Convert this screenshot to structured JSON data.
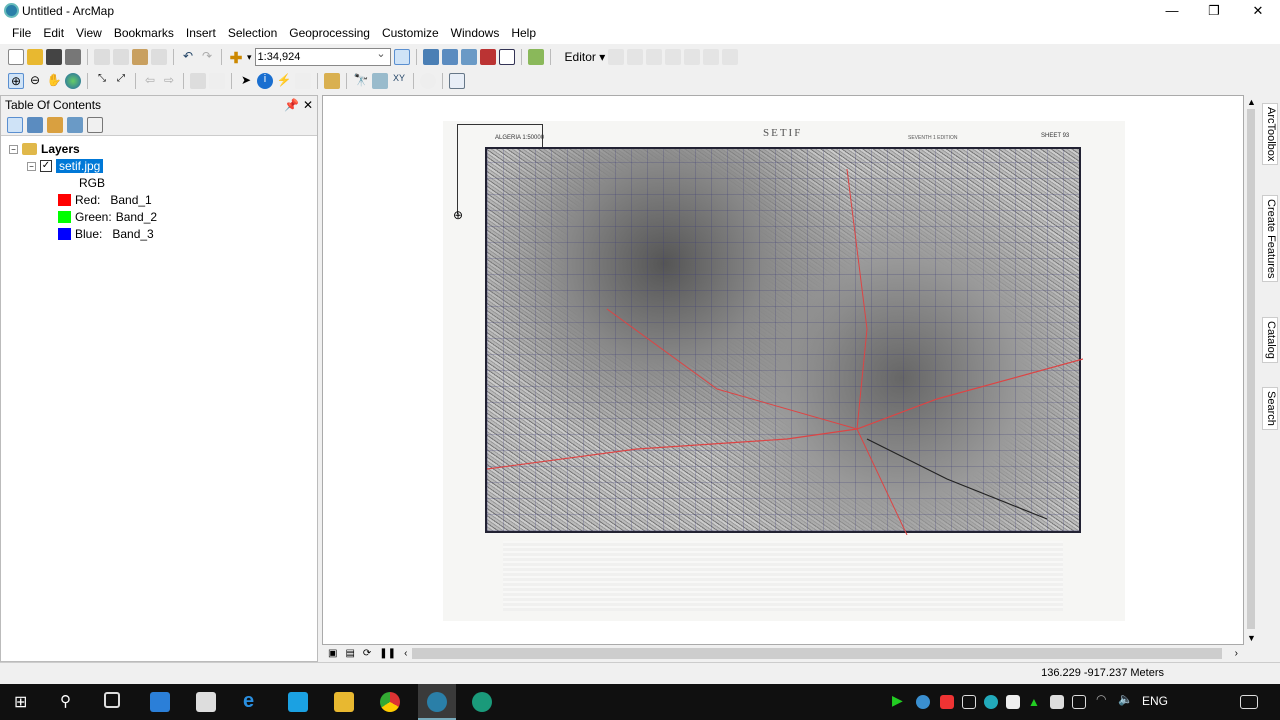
{
  "window": {
    "title": "Untitled - ArcMap",
    "minimize": "—",
    "restore": "❐",
    "close": "✕"
  },
  "menu": [
    "File",
    "Edit",
    "View",
    "Bookmarks",
    "Insert",
    "Selection",
    "Geoprocessing",
    "Customize",
    "Windows",
    "Help"
  ],
  "toolbar": {
    "scale": "1:34,924",
    "editor": "Editor ▾"
  },
  "toc": {
    "title": "Table Of Contents",
    "pin": "📌",
    "close": "✕",
    "layers_label": "Layers",
    "layer_name": "setif.jpg",
    "rgb": "RGB",
    "bands": [
      {
        "label": "Red:",
        "band": "Band_1",
        "color": "#ff0000"
      },
      {
        "label": "Green:",
        "band": "Band_2",
        "color": "#00ff00"
      },
      {
        "label": "Blue:",
        "band": "Band_3",
        "color": "#0000ff"
      }
    ]
  },
  "map": {
    "sheet_left": "ALGERIA 1:50000",
    "title": "SETIF",
    "edition": "SEVENTH 1 EDITION",
    "sheet_no": "SHEET 93"
  },
  "right_tabs": [
    "ArcToolbox",
    "Create Features",
    "Catalog",
    "Search"
  ],
  "status": {
    "coords": "136.229  -917.237 Meters"
  },
  "taskbar": {
    "lang": "ENG"
  }
}
